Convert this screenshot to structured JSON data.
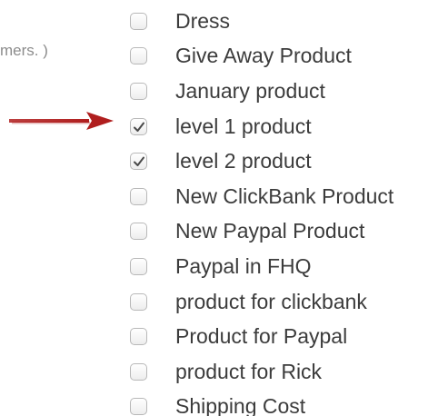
{
  "hint_text": "mers. )",
  "arrow": {
    "color": "#b01e1e",
    "icon": "red-arrow-icon"
  },
  "items": [
    {
      "label": "Dress",
      "checked": false
    },
    {
      "label": "Give Away Product",
      "checked": false
    },
    {
      "label": "January product",
      "checked": false
    },
    {
      "label": "level 1 product",
      "checked": true
    },
    {
      "label": "level 2 product",
      "checked": true
    },
    {
      "label": "New ClickBank Product",
      "checked": false
    },
    {
      "label": "New Paypal Product",
      "checked": false
    },
    {
      "label": "Paypal in FHQ",
      "checked": false
    },
    {
      "label": "product for clickbank",
      "checked": false
    },
    {
      "label": "Product for Paypal",
      "checked": false
    },
    {
      "label": "product for Rick",
      "checked": false
    },
    {
      "label": "Shipping Cost",
      "checked": false
    }
  ]
}
